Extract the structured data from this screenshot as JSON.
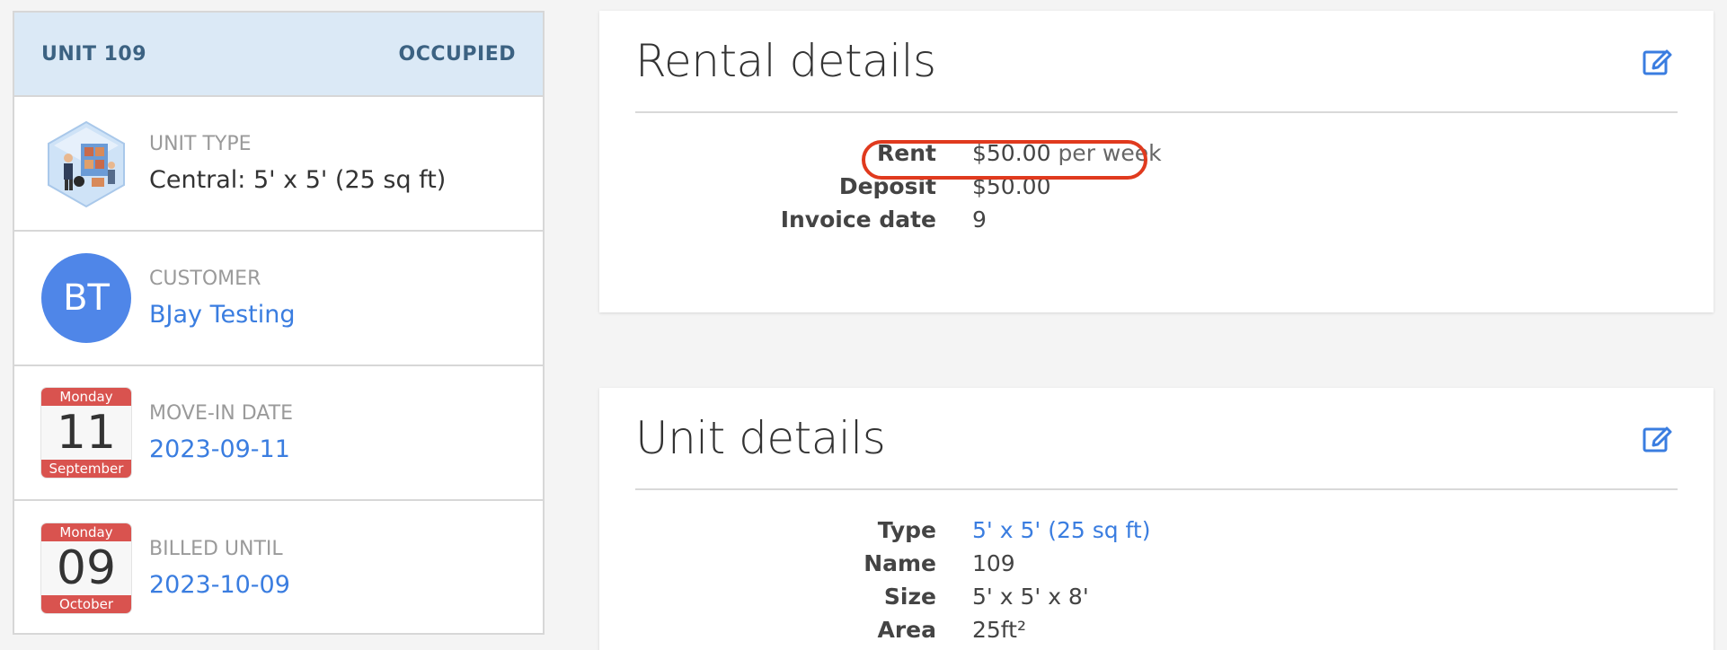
{
  "unit": {
    "title": "UNIT 109",
    "status": "OCCUPIED"
  },
  "unit_type": {
    "label": "UNIT TYPE",
    "value": "Central: 5' x 5' (25 sq ft)",
    "icon": "storage-unit-illustration"
  },
  "customer": {
    "label": "CUSTOMER",
    "initials": "BT",
    "name": "BJay Testing",
    "avatar_color": "#4f86e8"
  },
  "move_in": {
    "label": "MOVE-IN DATE",
    "value": "2023-09-11",
    "cal_weekday": "Monday",
    "cal_day": "11",
    "cal_month": "September"
  },
  "billed_until": {
    "label": "BILLED UNTIL",
    "value": "2023-10-09",
    "cal_weekday": "Monday",
    "cal_day": "09",
    "cal_month": "October"
  },
  "rental_details": {
    "title": "Rental details",
    "rent_label": "Rent",
    "rent_value": "$50.00",
    "rent_period": "per week",
    "deposit_label": "Deposit",
    "deposit_value": "$50.00",
    "invoice_label": "Invoice date",
    "invoice_value": "9"
  },
  "unit_details": {
    "title": "Unit details",
    "type_label": "Type",
    "type_value": "5' x 5' (25 sq ft)",
    "name_label": "Name",
    "name_value": "109",
    "size_label": "Size",
    "size_value": "5' x 5' x 8'",
    "area_label": "Area",
    "area_value": "25ft²"
  },
  "colors": {
    "accent": "#3a7de0",
    "header_bg": "#dbe9f6",
    "header_text": "#3c6282",
    "calendar_red": "#d9534f",
    "highlight_red": "#e03a1e"
  }
}
